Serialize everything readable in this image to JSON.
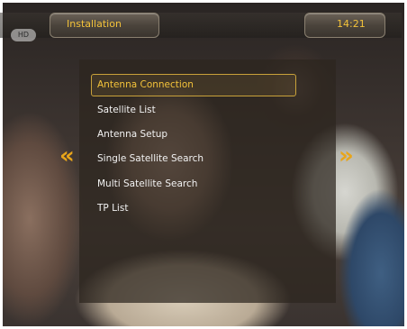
{
  "header": {
    "title": "Installation",
    "time": "14:21",
    "logo": "HD"
  },
  "menu": {
    "items": [
      {
        "label": "Antenna Connection",
        "selected": true
      },
      {
        "label": "Satellite List",
        "selected": false
      },
      {
        "label": "Antenna Setup",
        "selected": false
      },
      {
        "label": "Single Satellite Search",
        "selected": false
      },
      {
        "label": "Multi Satellite Search",
        "selected": false
      },
      {
        "label": "TP List",
        "selected": false
      }
    ]
  },
  "nav": {
    "left_arrow": "«",
    "right_arrow": "»"
  },
  "colors": {
    "accent": "#f3c23a",
    "arrow": "#e8a51a",
    "panel": "#2d261e"
  }
}
